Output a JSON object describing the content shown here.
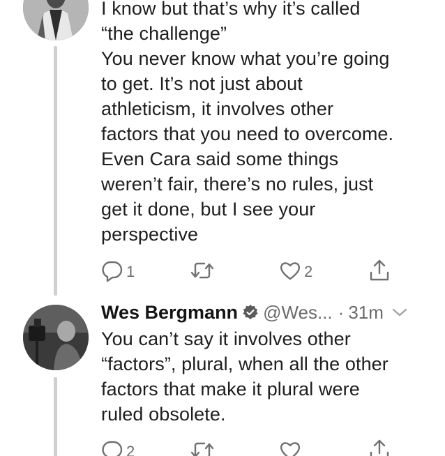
{
  "tweet1": {
    "lines": [
      "I know but that’s why it’s called",
      "“the challenge”",
      "You never know what you’re going",
      "to get. It’s not just about",
      "athleticism, it involves other",
      "factors that you need to overcome.",
      "Even Cara said some things",
      "weren’t fair, there’s no rules, just",
      "get it done, but I see your",
      "perspective"
    ],
    "actions": {
      "reply_count": "1",
      "retweet_count": "",
      "like_count": "2"
    }
  },
  "tweet2": {
    "display_name": "Wes Bergmann",
    "handle": "@Wes...",
    "dot": "·",
    "time": "31m",
    "lines": [
      "You can’t say it involves other",
      "“factors”, plural, when all the other",
      "factors that make it plural were",
      "ruled obsolete."
    ],
    "actions": {
      "reply_count": "2",
      "retweet_count": "",
      "like_count": ""
    }
  },
  "icons": {
    "reply": "reply-icon",
    "retweet": "retweet-icon",
    "like": "heart-icon",
    "share": "share-icon",
    "verified": "verified-badge-icon",
    "caret": "chevron-down-icon"
  },
  "colors": {
    "text": "#1e1e1e",
    "secondary": "#6e6e6e",
    "thread_line": "#cfcfcf"
  }
}
